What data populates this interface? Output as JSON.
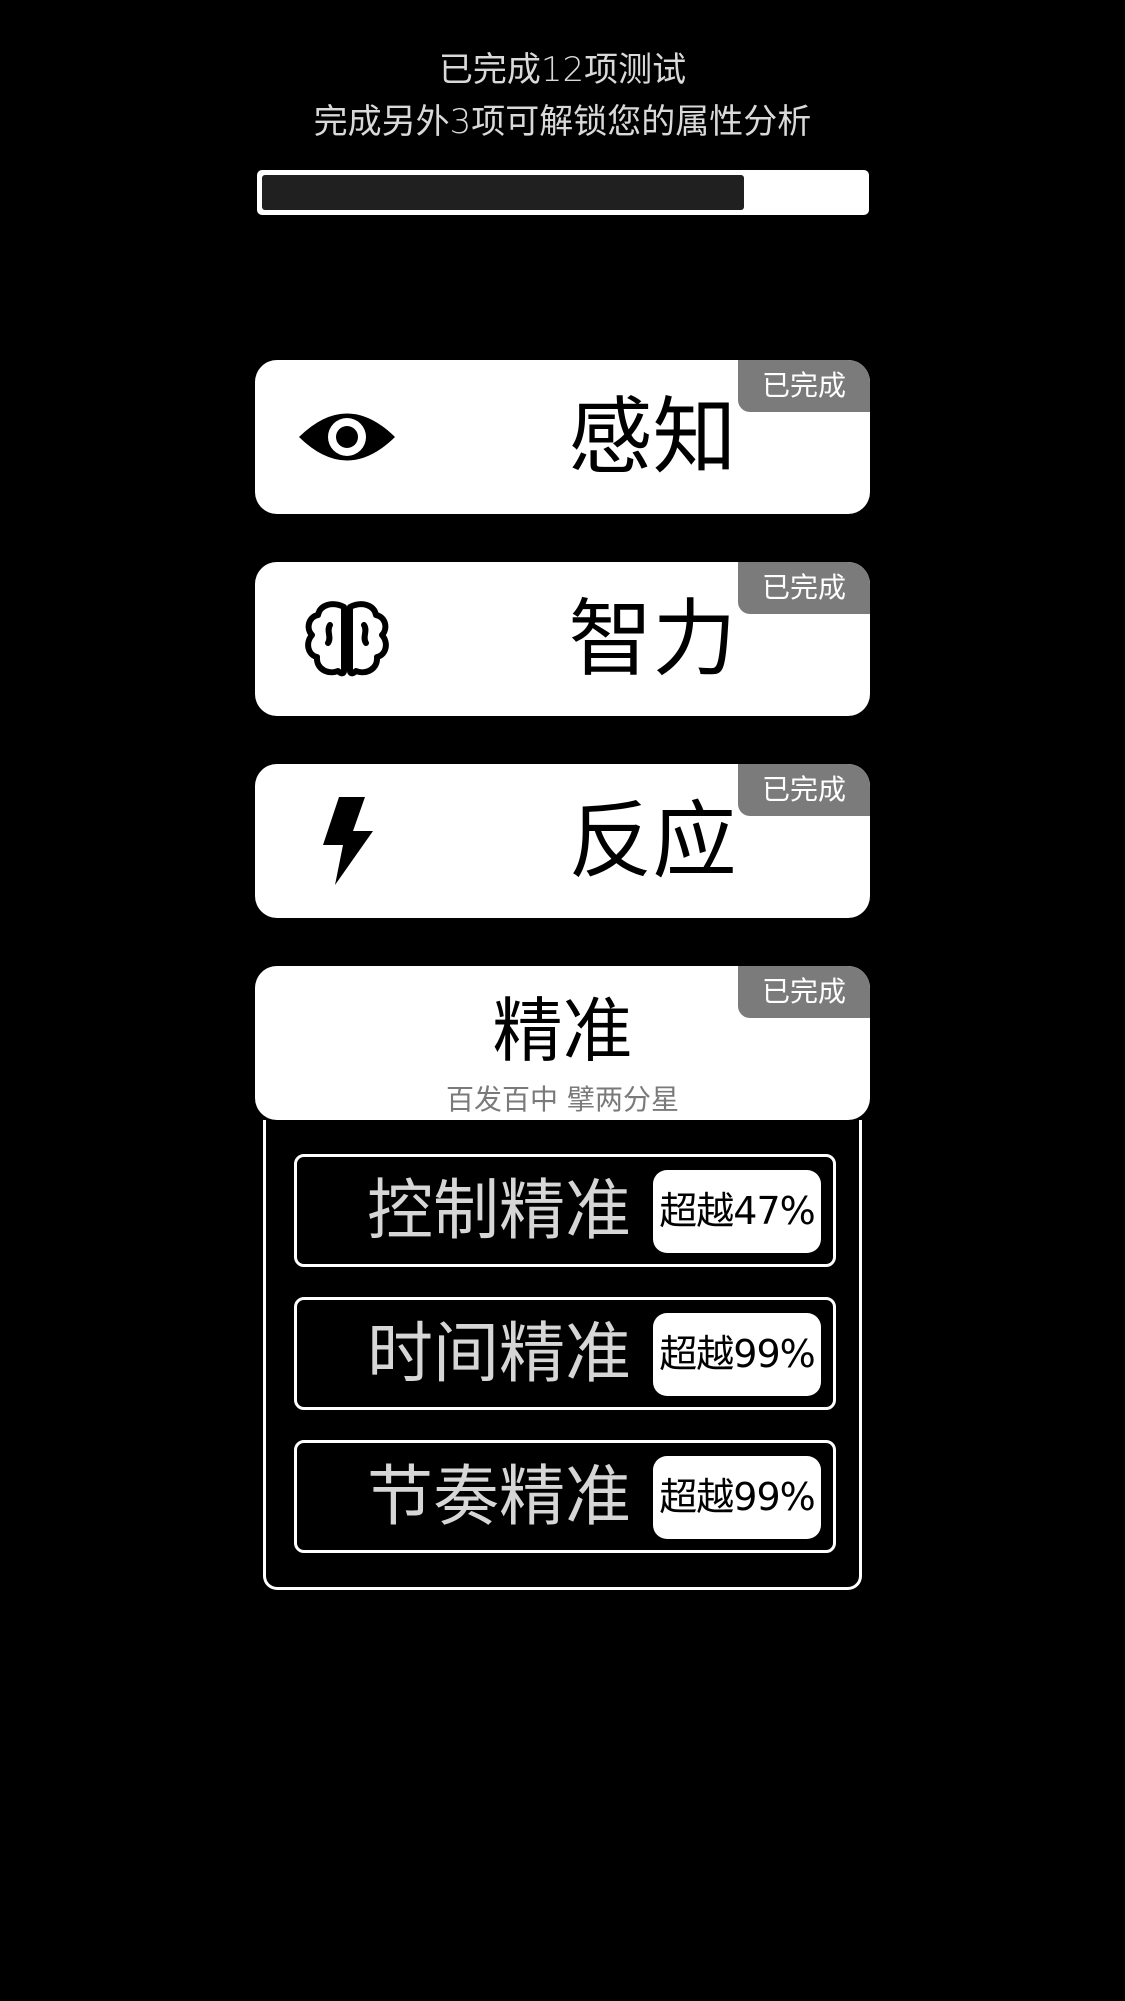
{
  "header": {
    "line1": "已完成12项测试",
    "line2": "完成另外3项可解锁您的属性分析"
  },
  "progress": {
    "completed": 12,
    "total": 15,
    "fraction": 0.8
  },
  "cards": [
    {
      "id": "perception",
      "title": "感知",
      "badge": "已完成",
      "icon": "eye-icon"
    },
    {
      "id": "intelligence",
      "title": "智力",
      "badge": "已完成",
      "icon": "brain-icon"
    },
    {
      "id": "reaction",
      "title": "反应",
      "badge": "已完成",
      "icon": "lightning-icon"
    },
    {
      "id": "precision",
      "title": "精准",
      "badge": "已完成",
      "subtitle": "百发百中 擘两分星",
      "expanded": true
    }
  ],
  "precision_items": [
    {
      "label": "控制精准",
      "value": "超越47%"
    },
    {
      "label": "时间精准",
      "value": "超越99%"
    },
    {
      "label": "节奏精准",
      "value": "超越99%"
    }
  ],
  "colors": {
    "background": "#000000",
    "card": "#ffffff",
    "badge": "#7b7b7b",
    "progress_fill": "#202020"
  }
}
